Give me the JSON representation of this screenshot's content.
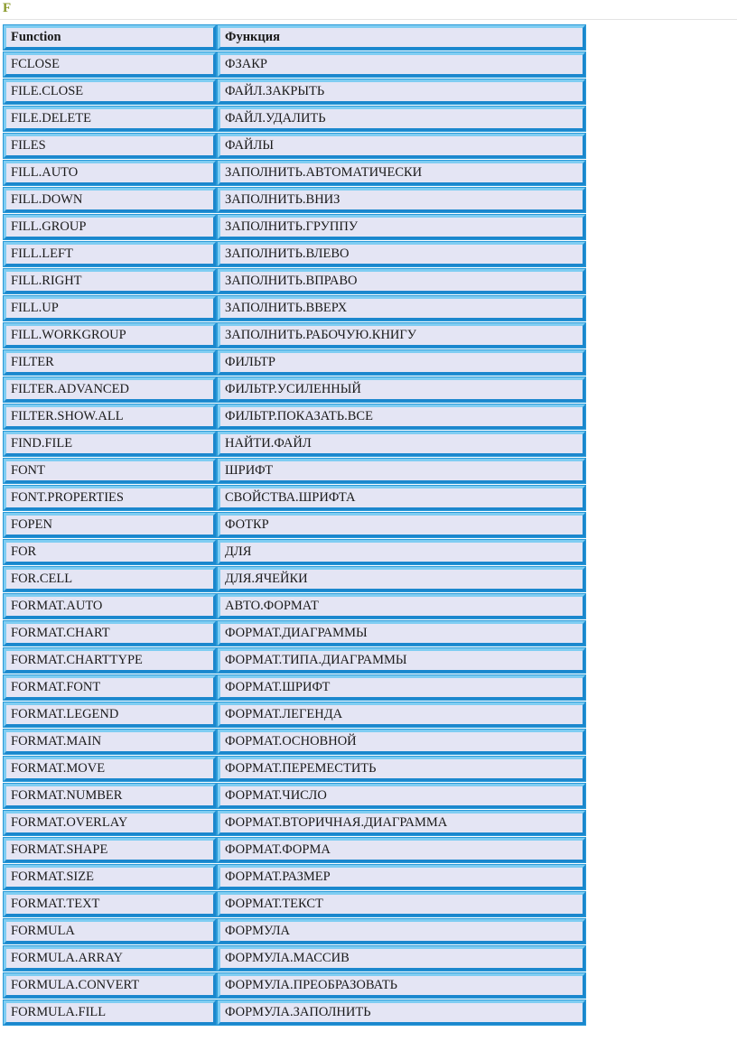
{
  "page": {
    "section_letter": "F",
    "background_color": "#ffffff",
    "letter_color": "#8a9a2b",
    "cell_background": "#e4e5f4",
    "border_light": "#7fcdf2",
    "border_dark": "#1b87cd",
    "rule_color": "#e3e3e3"
  },
  "table": {
    "headers": [
      "Function",
      "Функция"
    ],
    "rows": [
      [
        "FCLOSE",
        "ФЗАКР"
      ],
      [
        "FILE.CLOSE",
        "ФАЙЛ.ЗАКРЫТЬ"
      ],
      [
        "FILE.DELETE",
        "ФАЙЛ.УДАЛИТЬ"
      ],
      [
        "FILES",
        "ФАЙЛЫ"
      ],
      [
        "FILL.AUTO",
        "ЗАПОЛНИТЬ.АВТОМАТИЧЕСКИ"
      ],
      [
        "FILL.DOWN",
        "ЗАПОЛНИТЬ.ВНИЗ"
      ],
      [
        "FILL.GROUP",
        "ЗАПОЛНИТЬ.ГРУППУ"
      ],
      [
        "FILL.LEFT",
        "ЗАПОЛНИТЬ.ВЛЕВО"
      ],
      [
        "FILL.RIGHT",
        "ЗАПОЛНИТЬ.ВПРАВО"
      ],
      [
        "FILL.UP",
        "ЗАПОЛНИТЬ.ВВЕРХ"
      ],
      [
        "FILL.WORKGROUP",
        "ЗАПОЛНИТЬ.РАБОЧУЮ.КНИГУ"
      ],
      [
        "FILTER",
        "ФИЛЬТР"
      ],
      [
        "FILTER.ADVANCED",
        "ФИЛЬТР.УСИЛЕННЫЙ"
      ],
      [
        "FILTER.SHOW.ALL",
        "ФИЛЬТР.ПОКАЗАТЬ.ВСЕ"
      ],
      [
        "FIND.FILE",
        "НАЙТИ.ФАЙЛ"
      ],
      [
        "FONT",
        "ШРИФТ"
      ],
      [
        "FONT.PROPERTIES",
        "СВОЙСТВА.ШРИФТА"
      ],
      [
        "FOPEN",
        "ФОТКР"
      ],
      [
        "FOR",
        "ДЛЯ"
      ],
      [
        "FOR.CELL",
        "ДЛЯ.ЯЧЕЙКИ"
      ],
      [
        "FORMAT.AUTO",
        "АВТО.ФОРМАТ"
      ],
      [
        "FORMAT.CHART",
        "ФОРМАТ.ДИАГРАММЫ"
      ],
      [
        "FORMAT.CHARTTYPE",
        "ФОРМАТ.ТИПА.ДИАГРАММЫ"
      ],
      [
        "FORMAT.FONT",
        "ФОРМАТ.ШРИФТ"
      ],
      [
        "FORMAT.LEGEND",
        "ФОРМАТ.ЛЕГЕНДА"
      ],
      [
        "FORMAT.MAIN",
        "ФОРМАТ.ОСНОВНОЙ"
      ],
      [
        "FORMAT.MOVE",
        "ФОРМАТ.ПЕРЕМЕСТИТЬ"
      ],
      [
        "FORMAT.NUMBER",
        "ФОРМАТ.ЧИСЛО"
      ],
      [
        "FORMAT.OVERLAY",
        "ФОРМАТ.ВТОРИЧНАЯ.ДИАГРАММА"
      ],
      [
        "FORMAT.SHAPE",
        "ФОРМАТ.ФОРМА"
      ],
      [
        "FORMAT.SIZE",
        "ФОРМАТ.РАЗМЕР"
      ],
      [
        "FORMAT.TEXT",
        "ФОРМАТ.ТЕКСТ"
      ],
      [
        "FORMULA",
        "ФОРМУЛА"
      ],
      [
        "FORMULA.ARRAY",
        "ФОРМУЛА.МАССИВ"
      ],
      [
        "FORMULA.CONVERT",
        "ФОРМУЛА.ПРЕОБРАЗОВАТЬ"
      ],
      [
        "FORMULA.FILL",
        "ФОРМУЛА.ЗАПОЛНИТЬ"
      ]
    ]
  }
}
